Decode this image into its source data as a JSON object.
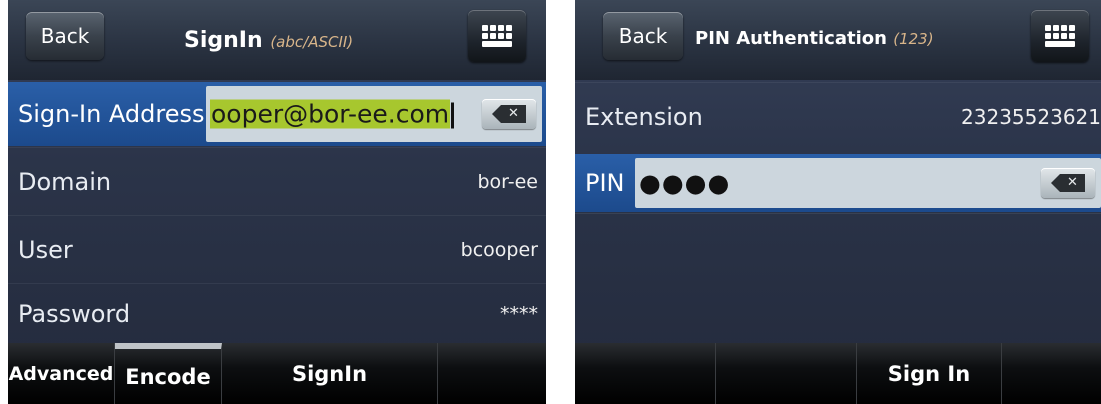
{
  "signin_screen": {
    "back_label": "Back",
    "title": "SignIn",
    "title_mode": "(abc/ASCII)",
    "keyboard_icon": "keyboard-icon",
    "address_label": "Sign-In Address",
    "address_value": "ooper@bor-ee.com",
    "backspace_icon": "backspace-icon",
    "fields": [
      {
        "label": "Domain",
        "value": "bor-ee"
      },
      {
        "label": "User",
        "value": "bcooper"
      },
      {
        "label": "Password",
        "value": "****"
      }
    ],
    "softkeys": [
      "Advanced",
      "Encode",
      "SignIn",
      ""
    ]
  },
  "pin_screen": {
    "back_label": "Back",
    "title": "PIN Authentication",
    "title_mode": "(123)",
    "keyboard_icon": "keyboard-icon",
    "extension_label": "Extension",
    "extension_value": "23235523621",
    "pin_label": "PIN",
    "pin_value": "●●●●",
    "backspace_icon": "backspace-icon",
    "softkeys": [
      "",
      "",
      "Sign In",
      ""
    ]
  }
}
